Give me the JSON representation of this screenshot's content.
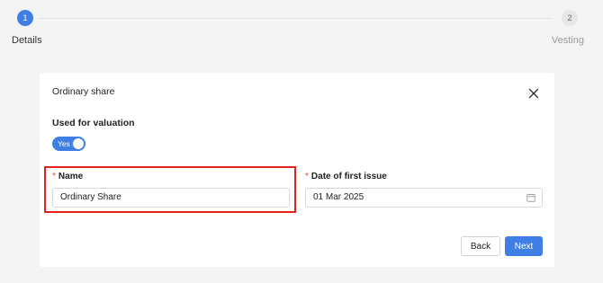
{
  "stepper": {
    "steps": [
      {
        "number": "1",
        "label": "Details",
        "state": "active"
      },
      {
        "number": "2",
        "label": "Vesting",
        "state": "inactive"
      }
    ],
    "active_color": "#3f7fe5"
  },
  "form": {
    "title": "Ordinary share",
    "close_icon": "close-icon",
    "valuation": {
      "label": "Used for valuation",
      "toggle_text": "Yes",
      "toggle_on": true
    },
    "name_field": {
      "required_mark": "*",
      "label": "Name",
      "value": "Ordinary Share",
      "highlight_color": "#e0221b"
    },
    "date_field": {
      "required_mark": "*",
      "label": "Date of first issue",
      "value": "01 Mar 2025",
      "icon": "calendar-icon"
    },
    "buttons": {
      "back_label": "Back",
      "next_label": "Next"
    }
  }
}
